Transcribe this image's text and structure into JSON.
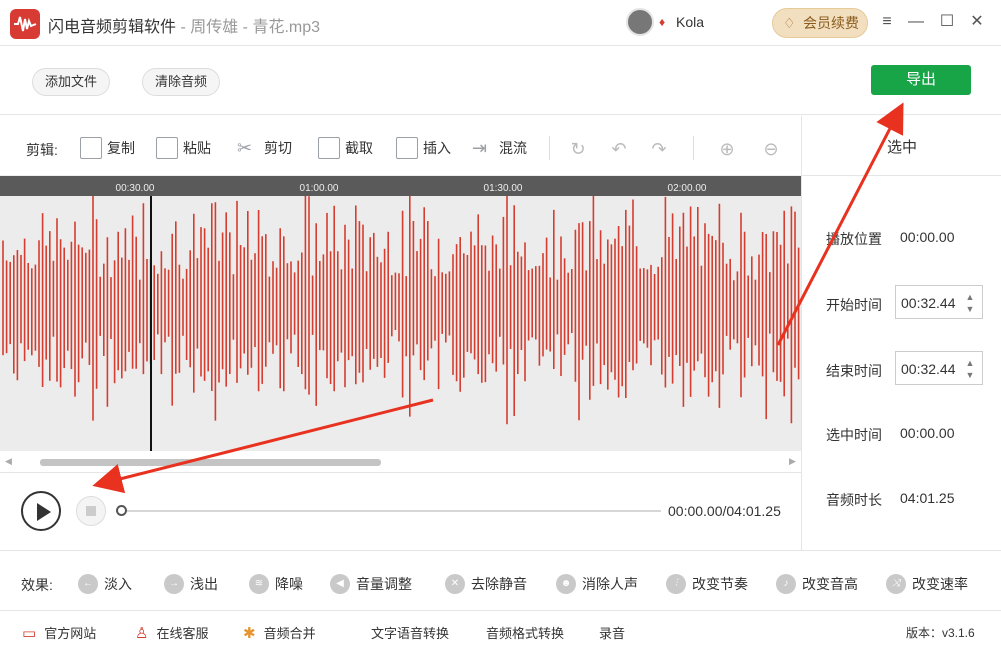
{
  "title": {
    "app_name": "闪电音频剪辑软件",
    "separator": " - ",
    "file_name": "周传雄 - 青花.mp3"
  },
  "user": {
    "name": "Kola",
    "renew_label": "会员续费"
  },
  "window": {
    "minimize": "—",
    "maximize": "☐",
    "close": "✕",
    "menu": "≡"
  },
  "top_actions": {
    "add_file": "添加文件",
    "clear_audio": "清除音频",
    "export": "导出"
  },
  "edit_toolbar": {
    "label": "剪辑:",
    "copy": "复制",
    "paste": "粘贴",
    "cut": "剪切",
    "crop": "截取",
    "insert": "插入",
    "mix": "混流"
  },
  "timeline": {
    "ticks": [
      "00:30.00",
      "01:00.00",
      "01:30.00",
      "02:00.00"
    ]
  },
  "right_panel": {
    "title": "选中",
    "play_position_label": "播放位置",
    "play_position": "00:00.00",
    "start_time_label": "开始时间",
    "start_time": "00:32.44",
    "end_time_label": "结束时间",
    "end_time": "00:32.44",
    "selected_time_label": "选中时间",
    "selected_time": "00:00.00",
    "duration_label": "音频时长",
    "duration": "04:01.25"
  },
  "player": {
    "time_display": "00:00.00/04:01.25"
  },
  "effects": {
    "label": "效果:",
    "items": [
      "淡入",
      "浅出",
      "降噪",
      "音量调整",
      "去除静音",
      "消除人声",
      "改变节奏",
      "改变音高",
      "改变速率"
    ]
  },
  "footer": {
    "website": "官方网站",
    "support": "在线客服",
    "merge": "音频合并",
    "tts": "文字语音转换",
    "convert": "音频格式转换",
    "record": "录音",
    "version": "版本：v3.1.6"
  },
  "colors": {
    "waveform": "#d43d2f",
    "export_button": "#18a548",
    "annotation_arrow": "#e8321f"
  }
}
